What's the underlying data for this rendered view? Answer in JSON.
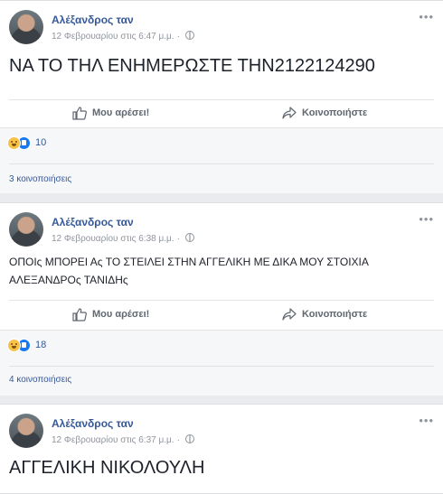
{
  "posts": [
    {
      "author": "Αλέξανδρος ταν",
      "date": "12 Φεβρουαρίου στις 6:47 μ.μ.",
      "more": "•••",
      "text": "ΝΑ ΤΟ ΤΗΛ ΕΝΗΜΕΡΩΣΤΕ ΤΗΝ2122124290",
      "like_label": "Μου αρέσει!",
      "share_label": "Κοινοποιήστε",
      "reactions": "10",
      "shares": "3 κοινοποιήσεις"
    },
    {
      "author": "Αλέξανδρος ταν",
      "date": "12 Φεβρουαρίου στις 6:38 μ.μ.",
      "more": "•••",
      "text": "ΟΠΟΙς ΜΠΟΡΕΙ Ας ΤΟ ΣΤΕΙΛΕΙ ΣΤΗΝ ΑΓΓΕΛΙΚΗ ΜΕ ΔΙΚΑ ΜΟΥ ΣΤΟΙΧΙΑ ΑΛΕΞΑΝΔΡΟς ΤΑΝΙΔΗς",
      "like_label": "Μου αρέσει!",
      "share_label": "Κοινοποιήστε",
      "reactions": "18",
      "shares": "4 κοινοποιήσεις"
    },
    {
      "author": "Αλέξανδρος ταν",
      "date": "12 Φεβρουαρίου στις 6:37 μ.μ.",
      "more": "•••",
      "text": "ΑΓΓΕΛΙΚΗ ΝΙΚΟΛΟΥΛΗ"
    }
  ],
  "separator": "·",
  "colors": {
    "link": "#365899",
    "meta": "#90949c",
    "background": "#e9ebee",
    "like": "#1877f2",
    "haha": "#f7c14a"
  },
  "icons": [
    "avatar",
    "globe-icon",
    "more-options-icon",
    "like-thumb-icon",
    "share-arrow-icon",
    "haha-reaction-icon",
    "like-reaction-icon"
  ]
}
